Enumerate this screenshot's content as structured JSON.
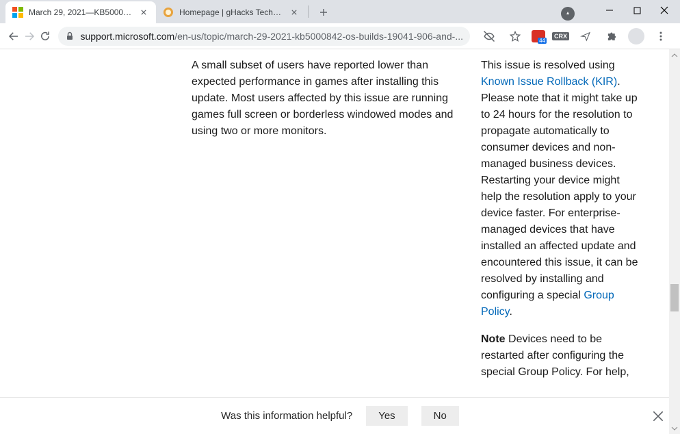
{
  "tabs": [
    {
      "title": "March 29, 2021—KB5000842 (OS",
      "active": true
    },
    {
      "title": "Homepage | gHacks Technology",
      "active": false
    }
  ],
  "url": {
    "domain": "support.microsoft.com",
    "path": "/en-us/topic/march-29-2021-kb5000842-os-builds-19041-906-and-..."
  },
  "left_col_text": "A small subset of users have reported lower than expected performance in games after installing this update. Most users affected by this issue are running games full screen or borderless windowed modes and using two or more monitors.",
  "right_col": {
    "p1_pre": "This issue is resolved using ",
    "p1_link": "Known Issue Rollback (KIR)",
    "p1_mid": ". Please note that it might take up to 24 hours for the resolution to propagate automatically to consumer devices and non-managed business devices. Restarting your device might help the resolution apply to your device faster. For enterprise-managed devices that have installed an affected update and encountered this issue, it can be resolved by installing and configuring a special ",
    "p1_link2": "Group Policy",
    "p1_post": ".",
    "p2_strong": "Note",
    "p2_rest": " Devices need to be restarted after configuring the special Group Policy. For help,"
  },
  "feedback": {
    "question": "Was this information helpful?",
    "yes": "Yes",
    "no": "No"
  },
  "crx_label": "CRX"
}
